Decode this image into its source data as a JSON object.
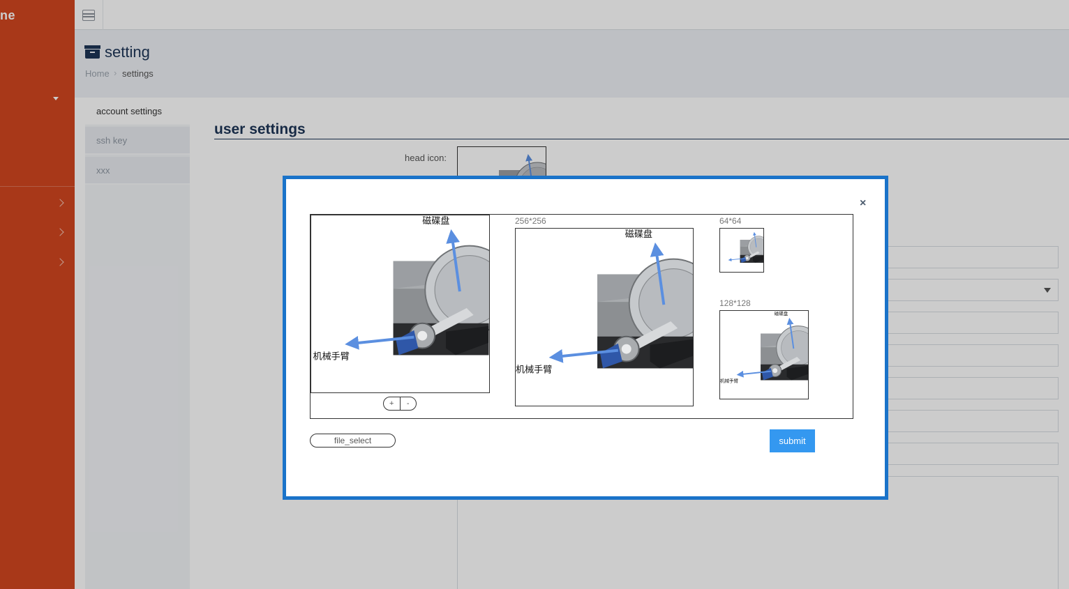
{
  "sidebar": {
    "brand": "ne",
    "items": [
      {
        "icon": "caret-down-icon"
      },
      {
        "icon": "chevron-right-icon"
      },
      {
        "icon": "chevron-right-icon"
      },
      {
        "icon": "chevron-right-icon"
      }
    ],
    "color": "#d24620"
  },
  "topbar": {
    "menu_icon": "menu-icon"
  },
  "header": {
    "title": "setting",
    "title_icon": "archive-icon",
    "breadcrumb": {
      "home": "Home",
      "separator": "›",
      "current": "settings"
    }
  },
  "tabs": [
    {
      "label": "account settings",
      "active": true
    },
    {
      "label": "ssh key",
      "active": false
    },
    {
      "label": "xxx",
      "active": false
    }
  ],
  "section": {
    "title": "user settings",
    "head_icon_label": "head icon:"
  },
  "modal": {
    "close_label": "×",
    "image_labels": {
      "top": "磁碟盘",
      "bottom": "机械手臂"
    },
    "previews": [
      {
        "label": "256*256"
      },
      {
        "label": "64*64"
      },
      {
        "label": "128*128"
      }
    ],
    "zoom_in": "+",
    "zoom_out": "-",
    "file_select": "file_select",
    "submit": "submit",
    "accent": "#1a73c9",
    "submit_color": "#3498f0"
  }
}
